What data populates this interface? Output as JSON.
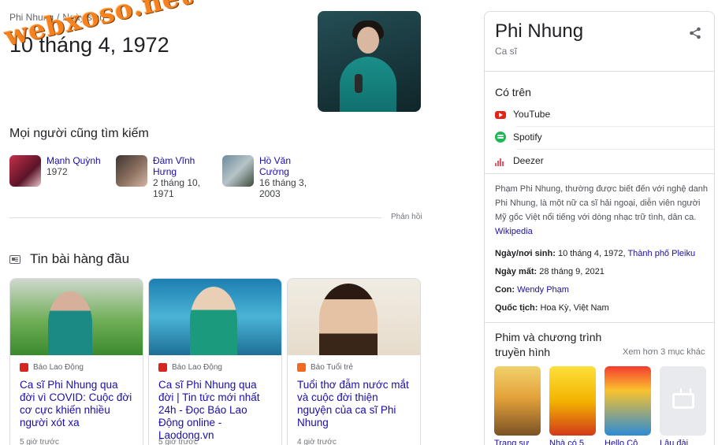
{
  "watermark": "webxoso.net",
  "breadcrumb": {
    "parent": "Phi Nhung",
    "separator": "/",
    "current": "Ngày sinh"
  },
  "answer": "10 tháng 4, 1972",
  "people_also_search": {
    "heading": "Mọi người cũng tìm kiếm",
    "items": [
      {
        "name": "Mạnh Quỳnh",
        "detail": "1972"
      },
      {
        "name": "Đàm Vĩnh Hưng",
        "detail": "2 tháng 10, 1971"
      },
      {
        "name": "Hồ Văn Cường",
        "detail": "16 tháng 3, 2003"
      }
    ],
    "feedback": "Phản hồi"
  },
  "top_stories": {
    "heading": "Tin bài hàng đầu",
    "cards": [
      {
        "source": "Báo Lao Động",
        "headline": "Ca sĩ Phi Nhung qua đời vì COVID: Cuộc đời cơ cực khiến nhiều người xót xa",
        "time": "5 giờ trước"
      },
      {
        "source": "Báo Lao Động",
        "headline": "Ca sĩ Phi Nhung qua đời | Tin tức mới nhất 24h - Đọc Báo Lao Động online - Laodong.vn",
        "time": "5 giờ trước"
      },
      {
        "source": "Báo Tuổi trẻ",
        "headline": "Tuổi thơ đẫm nước mắt và cuộc đời thiện nguyện của ca sĩ Phi Nhung",
        "time": "4 giờ trước"
      }
    ]
  },
  "knowledge_panel": {
    "title": "Phi Nhung",
    "subtitle": "Ca sĩ",
    "on_heading": "Có trên",
    "services": [
      "YouTube",
      "Spotify",
      "Deezer"
    ],
    "description": "Phạm Phi Nhung, thường được biết đến với nghệ danh Phi Nhung, là một nữ ca sĩ hải ngoại, diễn viên người Mỹ gốc Việt nổi tiếng với dòng nhạc trữ tình, dân ca.",
    "description_source": "Wikipedia",
    "facts": [
      {
        "label": "Ngày/nơi sinh:",
        "value": "10 tháng 4, 1972,",
        "link": "Thành phố Pleiku"
      },
      {
        "label": "Ngày mất:",
        "value": "28 tháng 9, 2021",
        "link": ""
      },
      {
        "label": "Con:",
        "value": "",
        "link": "Wendy Phạm"
      },
      {
        "label": "Quốc tịch:",
        "value": "Hoa Kỳ, Việt Nam",
        "link": ""
      }
    ],
    "films_heading": "Phim và chương trình truyền hình",
    "more_label": "Xem hơn 3 mục khác",
    "films": [
      "Trang sư",
      "Nhà có 5",
      "Hello Cô",
      "Lâu đài"
    ]
  }
}
